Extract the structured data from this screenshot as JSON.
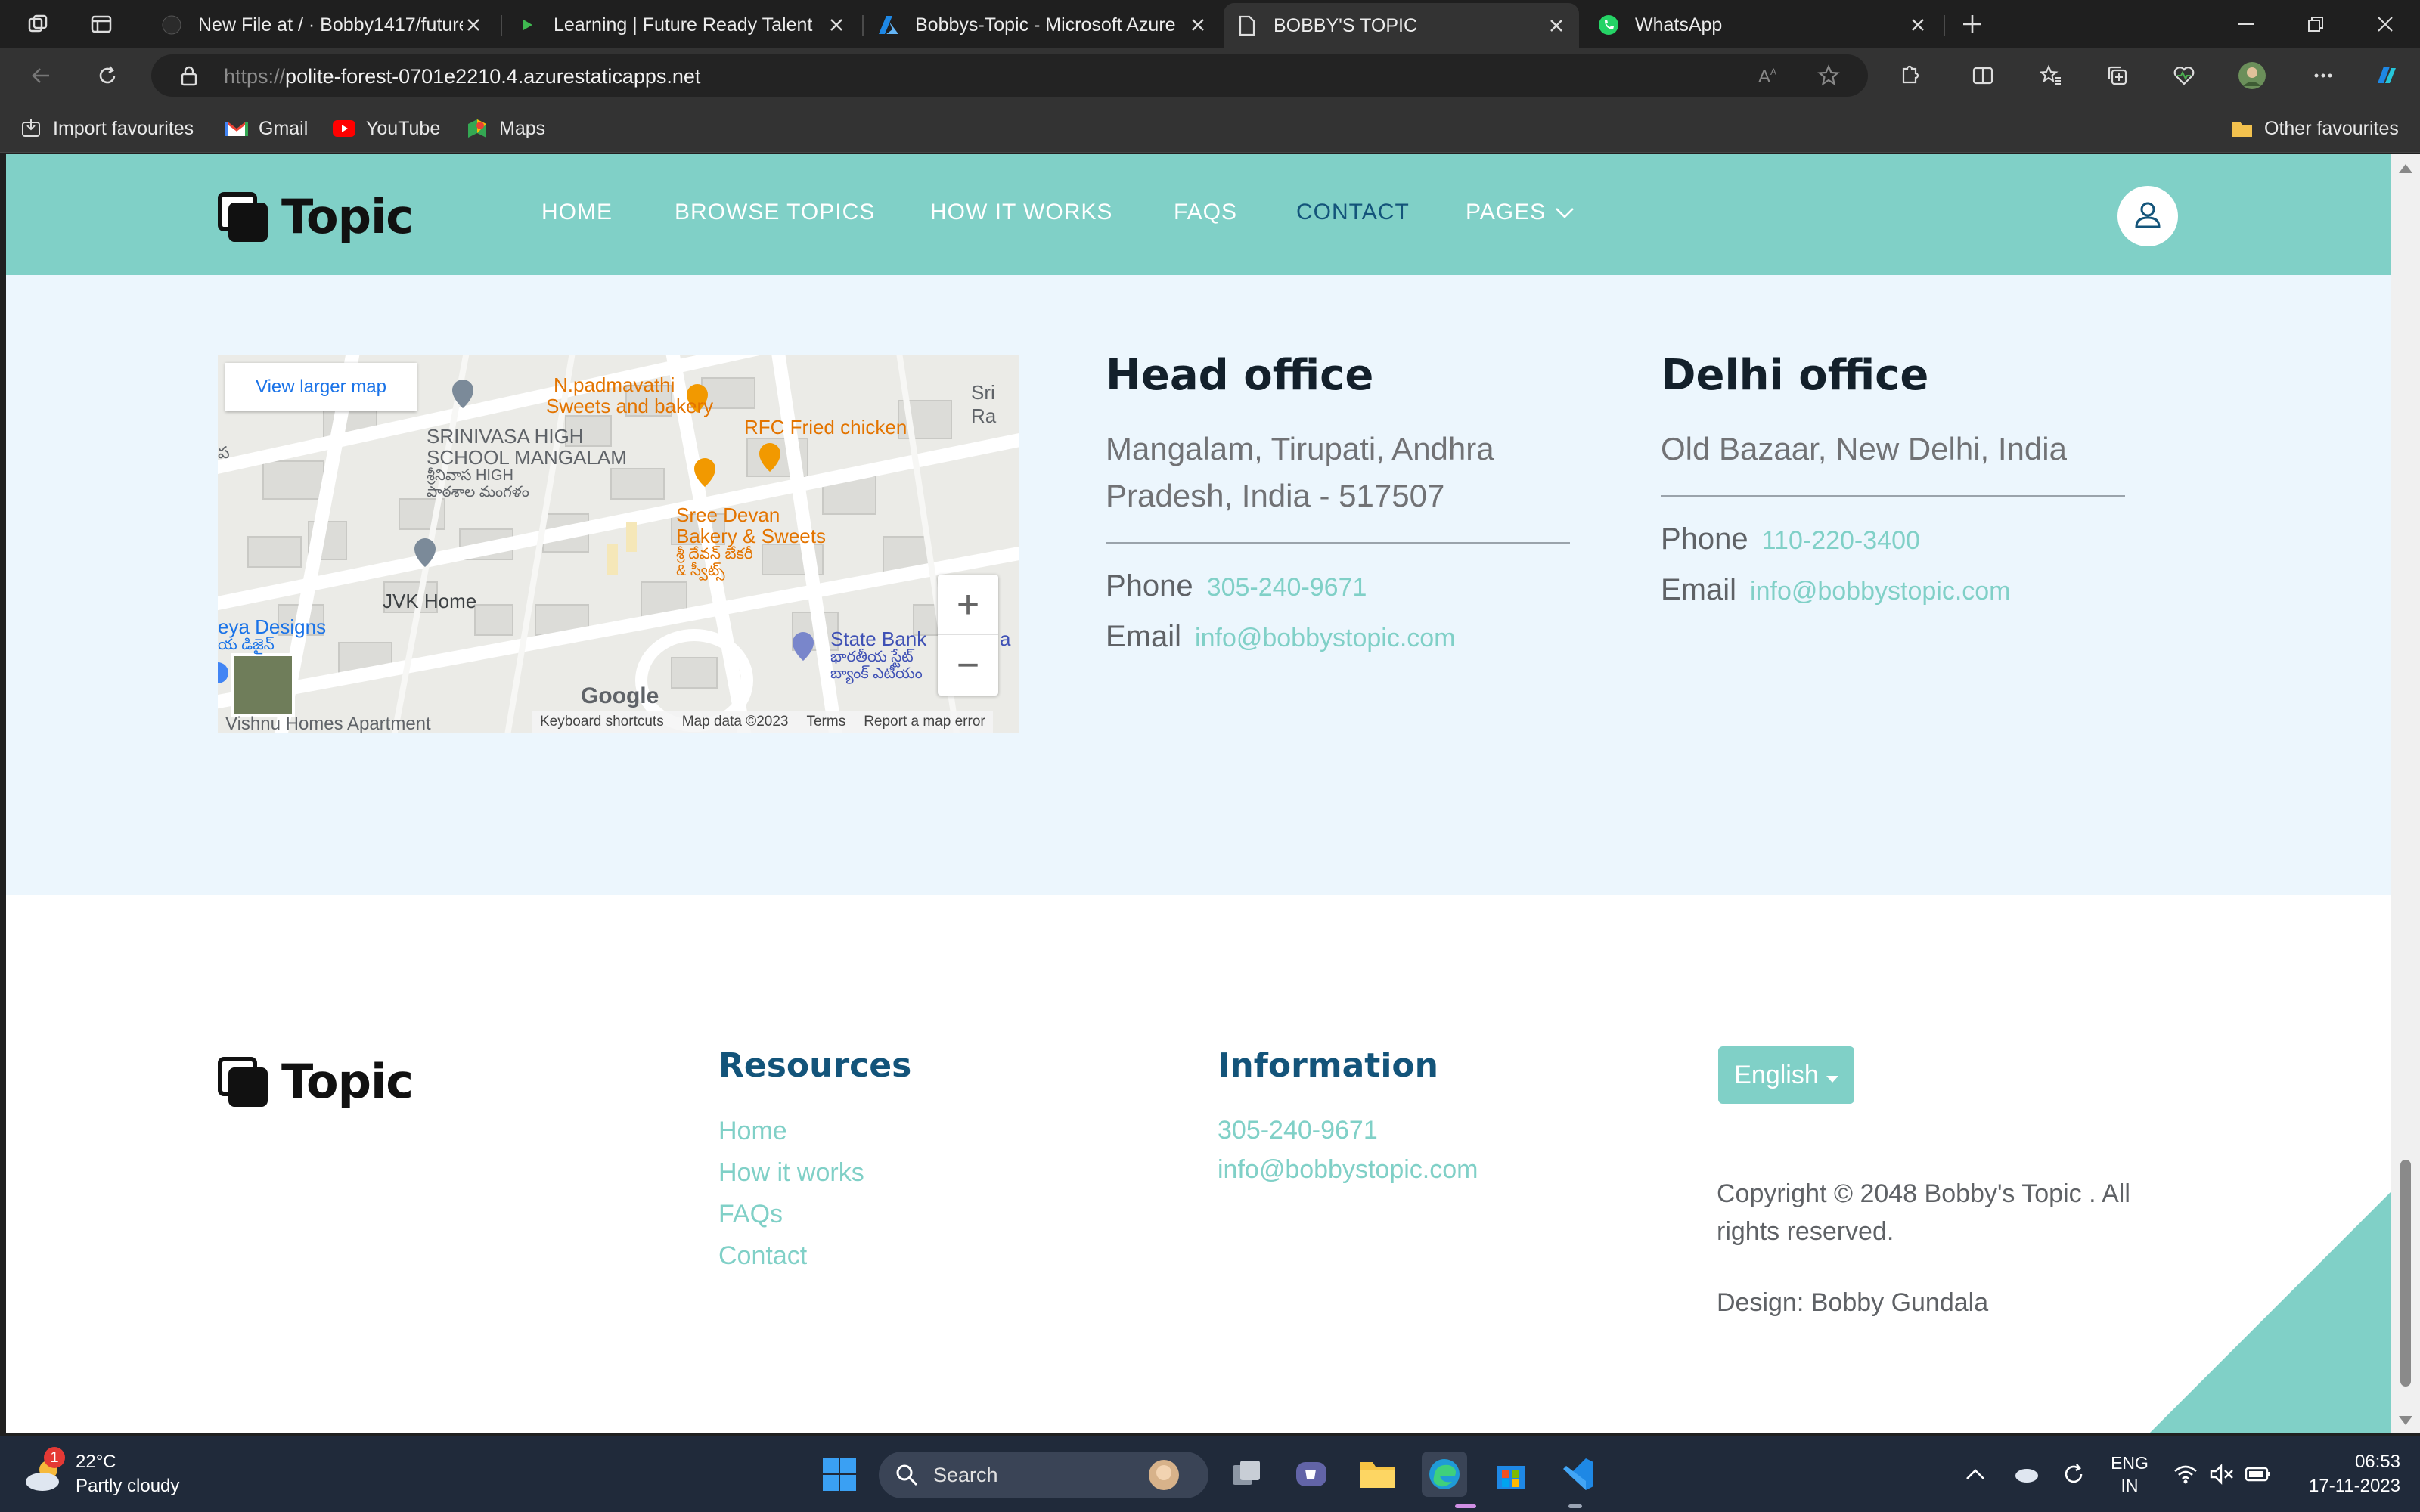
{
  "browser": {
    "tabs": [
      {
        "title": "New File at / · Bobby1417/future",
        "icon": "github-icon",
        "active": false
      },
      {
        "title": "Learning | Future Ready Talent",
        "icon": "play-icon",
        "active": false
      },
      {
        "title": "Bobbys-Topic - Microsoft Azure",
        "icon": "azure-icon",
        "active": false
      },
      {
        "title": "BOBBY'S TOPIC",
        "icon": "page-icon",
        "active": true
      },
      {
        "title": "WhatsApp",
        "icon": "whatsapp-icon",
        "active": false
      }
    ],
    "url_prefix": "https://",
    "url_host": "polite-forest-0701e2210.4.azurestaticapps.net",
    "bookmarks": [
      {
        "label": "Import favourites",
        "icon": "import-icon"
      },
      {
        "label": "Gmail",
        "icon": "gmail-icon"
      },
      {
        "label": "YouTube",
        "icon": "youtube-icon"
      },
      {
        "label": "Maps",
        "icon": "maps-icon"
      }
    ],
    "other_favourites": "Other favourites"
  },
  "site": {
    "logo": "Topic",
    "nav": [
      "HOME",
      "BROWSE TOPICS",
      "HOW IT WORKS",
      "FAQS",
      "CONTACT",
      "PAGES"
    ],
    "active_nav": "CONTACT",
    "accent": "#80d0c7",
    "primary": "#13547a"
  },
  "map": {
    "view_larger": "View larger map",
    "labels": {
      "padmavathi": "N.padmavathi",
      "padmavathi2": "Sweets and bakery",
      "srinivasa1": "SRINIVASA HIGH",
      "srinivasa2": "SCHOOL MANGALAM",
      "srinivasa_te1": "శ్రీనివాస HIGH",
      "srinivasa_te2": "పాఠశాల మంగళం",
      "rfc": "RFC Fried chicken",
      "sri_ra": "Sri Ra",
      "devan1": "Sree Devan",
      "devan2": "Bakery & Sweets",
      "devan_te1": "శ్రీ దేవన్ బేకరీ",
      "devan_te2": "& స్వీట్స్",
      "jvk": "JVK Home",
      "eya": "eya Designs",
      "eya_te": "య డిజైన్",
      "state_bank": "State Bank",
      "state_bank_te1": "భారతీయ స్టేట్",
      "state_bank_te2": "బ్యాంక్ ఎటీయం",
      "a_suffix": "a",
      "vishnu": "Vishnu Homes Apartment",
      "left_char": "ప"
    },
    "google": "Google",
    "keyboard": "Keyboard shortcuts",
    "mapdata": "Map data ©2023",
    "terms": "Terms",
    "report": "Report a map error",
    "zoom_in": "+",
    "zoom_out": "−"
  },
  "head_office": {
    "title": "Head office",
    "address": "Mangalam, Tirupati, Andhra Pradesh, India - 517507",
    "phone_label": "Phone",
    "phone": "305-240-9671",
    "email_label": "Email",
    "email": "info@bobbystopic.com"
  },
  "delhi_office": {
    "title": "Delhi office",
    "address": "Old Bazaar, New Delhi, India",
    "phone_label": "Phone",
    "phone": "110-220-3400",
    "email_label": "Email",
    "email": "info@bobbystopic.com"
  },
  "footer": {
    "logo": "Topic",
    "resources_title": "Resources",
    "resources": [
      "Home",
      "How it works",
      "FAQs",
      "Contact"
    ],
    "information_title": "Information",
    "phone": "305-240-9671",
    "email": "info@bobbystopic.com",
    "language": "English",
    "copyright": "Copyright © 2048 Bobby's Topic . All rights reserved.",
    "design": "Design: Bobby Gundala"
  },
  "taskbar": {
    "weather_badge": "1",
    "temperature": "22°C",
    "weather": "Partly cloudy",
    "search": "Search",
    "lang1": "ENG",
    "lang2": "IN",
    "time": "06:53",
    "date": "17-11-2023"
  }
}
